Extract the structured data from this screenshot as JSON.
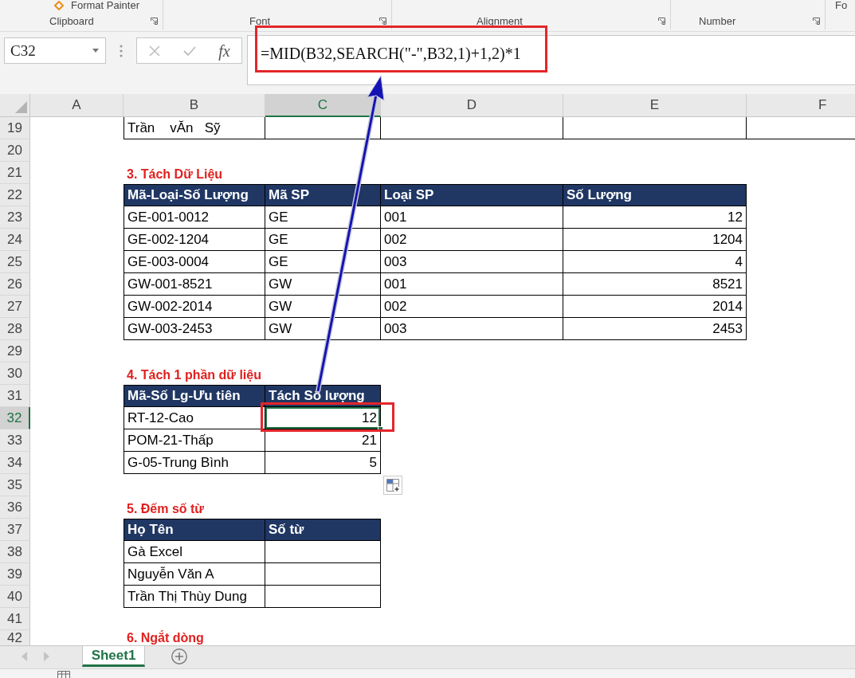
{
  "ribbon": {
    "groups": [
      {
        "label": "Clipboard",
        "items": [
          {
            "kind": "format-painter",
            "label": "Format Painter"
          }
        ]
      },
      {
        "label": "Font"
      },
      {
        "label": "Alignment"
      },
      {
        "label": "Number"
      },
      {
        "items": [
          {
            "kind": "plain",
            "label": "Fo"
          }
        ]
      }
    ]
  },
  "formula_bar": {
    "name_box": "C32",
    "insert_function": "fx",
    "formula": "=MID(B32,SEARCH(\"-\",B32,1)+1,2)*1"
  },
  "sheet": {
    "columns": [
      {
        "label": "A",
        "selected": false
      },
      {
        "label": "B",
        "selected": false
      },
      {
        "label": "C",
        "selected": true
      },
      {
        "label": "D",
        "selected": false
      },
      {
        "label": "E",
        "selected": false
      },
      {
        "label": "F",
        "selected": false
      }
    ],
    "rows": [
      {
        "number": "19",
        "selected": false,
        "cells": [
          {
            "kind": "none"
          },
          {
            "kind": "text",
            "text": "Trần    vĂn   Sỹ"
          },
          {
            "kind": "blank"
          },
          {
            "kind": "blank"
          },
          {
            "kind": "blank"
          },
          {
            "kind": "blank"
          }
        ]
      },
      {
        "number": "20",
        "selected": false,
        "cells": [
          {
            "kind": "none"
          },
          {
            "kind": "none"
          },
          {
            "kind": "none"
          },
          {
            "kind": "none"
          },
          {
            "kind": "none"
          },
          {
            "kind": "none"
          }
        ]
      },
      {
        "number": "21",
        "selected": false,
        "cells": [
          {
            "kind": "none"
          },
          {
            "kind": "title",
            "text": "3. Tách Dữ Liệu"
          },
          {
            "kind": "none"
          },
          {
            "kind": "none"
          },
          {
            "kind": "none"
          },
          {
            "kind": "none"
          }
        ]
      },
      {
        "number": "22",
        "selected": false,
        "cells": [
          {
            "kind": "none"
          },
          {
            "kind": "header",
            "text": "Mã-Loại-Số Lượng"
          },
          {
            "kind": "header",
            "text": "Mã SP"
          },
          {
            "kind": "header",
            "text": "Loại SP"
          },
          {
            "kind": "header",
            "text": "Số Lượng"
          },
          {
            "kind": "none"
          }
        ]
      },
      {
        "number": "23",
        "selected": false,
        "cells": [
          {
            "kind": "none"
          },
          {
            "kind": "text",
            "text": "GE-001-0012"
          },
          {
            "kind": "text",
            "text": "GE"
          },
          {
            "kind": "text",
            "text": "001"
          },
          {
            "kind": "number",
            "text": "12"
          },
          {
            "kind": "none"
          }
        ]
      },
      {
        "number": "24",
        "selected": false,
        "cells": [
          {
            "kind": "none"
          },
          {
            "kind": "text",
            "text": "GE-002-1204"
          },
          {
            "kind": "text",
            "text": "GE"
          },
          {
            "kind": "text",
            "text": "002"
          },
          {
            "kind": "number",
            "text": "1204"
          },
          {
            "kind": "none"
          }
        ]
      },
      {
        "number": "25",
        "selected": false,
        "cells": [
          {
            "kind": "none"
          },
          {
            "kind": "text",
            "text": "GE-003-0004"
          },
          {
            "kind": "text",
            "text": "GE"
          },
          {
            "kind": "text",
            "text": "003"
          },
          {
            "kind": "number",
            "text": "4"
          },
          {
            "kind": "none"
          }
        ]
      },
      {
        "number": "26",
        "selected": false,
        "cells": [
          {
            "kind": "none"
          },
          {
            "kind": "text",
            "text": "GW-001-8521"
          },
          {
            "kind": "text",
            "text": "GW"
          },
          {
            "kind": "text",
            "text": "001"
          },
          {
            "kind": "number",
            "text": "8521"
          },
          {
            "kind": "none"
          }
        ]
      },
      {
        "number": "27",
        "selected": false,
        "cells": [
          {
            "kind": "none"
          },
          {
            "kind": "text",
            "text": "GW-002-2014"
          },
          {
            "kind": "text",
            "text": "GW"
          },
          {
            "kind": "text",
            "text": "002"
          },
          {
            "kind": "number",
            "text": "2014"
          },
          {
            "kind": "none"
          }
        ]
      },
      {
        "number": "28",
        "selected": false,
        "cells": [
          {
            "kind": "none"
          },
          {
            "kind": "text",
            "text": "GW-003-2453"
          },
          {
            "kind": "text",
            "text": "GW"
          },
          {
            "kind": "text",
            "text": "003"
          },
          {
            "kind": "number",
            "text": "2453"
          },
          {
            "kind": "none"
          }
        ]
      },
      {
        "number": "29",
        "selected": false,
        "cells": [
          {
            "kind": "none"
          },
          {
            "kind": "none"
          },
          {
            "kind": "none"
          },
          {
            "kind": "none"
          },
          {
            "kind": "none"
          },
          {
            "kind": "none"
          }
        ]
      },
      {
        "number": "30",
        "selected": false,
        "cells": [
          {
            "kind": "none"
          },
          {
            "kind": "title",
            "text": "4. Tách 1 phần dữ liệu"
          },
          {
            "kind": "none"
          },
          {
            "kind": "none"
          },
          {
            "kind": "none"
          },
          {
            "kind": "none"
          }
        ]
      },
      {
        "number": "31",
        "selected": false,
        "cells": [
          {
            "kind": "none"
          },
          {
            "kind": "header",
            "text": "Mã-Số Lg-Ưu tiên"
          },
          {
            "kind": "header",
            "text": "Tách Số lượng"
          },
          {
            "kind": "none"
          },
          {
            "kind": "none"
          },
          {
            "kind": "none"
          }
        ]
      },
      {
        "number": "32",
        "selected": true,
        "cells": [
          {
            "kind": "none"
          },
          {
            "kind": "text",
            "text": "RT-12-Cao"
          },
          {
            "kind": "number",
            "text": "12"
          },
          {
            "kind": "none"
          },
          {
            "kind": "none"
          },
          {
            "kind": "none"
          }
        ]
      },
      {
        "number": "33",
        "selected": false,
        "cells": [
          {
            "kind": "none"
          },
          {
            "kind": "text",
            "text": "POM-21-Thấp"
          },
          {
            "kind": "number",
            "text": "21"
          },
          {
            "kind": "none"
          },
          {
            "kind": "none"
          },
          {
            "kind": "none"
          }
        ]
      },
      {
        "number": "34",
        "selected": false,
        "cells": [
          {
            "kind": "none"
          },
          {
            "kind": "text",
            "text": "G-05-Trung Bình"
          },
          {
            "kind": "number",
            "text": "5"
          },
          {
            "kind": "none"
          },
          {
            "kind": "none"
          },
          {
            "kind": "none"
          }
        ]
      },
      {
        "number": "35",
        "selected": false,
        "cells": [
          {
            "kind": "none"
          },
          {
            "kind": "none"
          },
          {
            "kind": "none"
          },
          {
            "kind": "none"
          },
          {
            "kind": "none"
          },
          {
            "kind": "none"
          }
        ]
      },
      {
        "number": "36",
        "selected": false,
        "cells": [
          {
            "kind": "none"
          },
          {
            "kind": "title",
            "text": "5. Đếm số từ"
          },
          {
            "kind": "none"
          },
          {
            "kind": "none"
          },
          {
            "kind": "none"
          },
          {
            "kind": "none"
          }
        ]
      },
      {
        "number": "37",
        "selected": false,
        "cells": [
          {
            "kind": "none"
          },
          {
            "kind": "header",
            "text": "Họ Tên"
          },
          {
            "kind": "header",
            "text": "Số từ"
          },
          {
            "kind": "none"
          },
          {
            "kind": "none"
          },
          {
            "kind": "none"
          }
        ]
      },
      {
        "number": "38",
        "selected": false,
        "cells": [
          {
            "kind": "none"
          },
          {
            "kind": "text",
            "text": "Gà Excel"
          },
          {
            "kind": "blank"
          },
          {
            "kind": "none"
          },
          {
            "kind": "none"
          },
          {
            "kind": "none"
          }
        ]
      },
      {
        "number": "39",
        "selected": false,
        "cells": [
          {
            "kind": "none"
          },
          {
            "kind": "text",
            "text": "Nguyễn Văn A"
          },
          {
            "kind": "blank"
          },
          {
            "kind": "none"
          },
          {
            "kind": "none"
          },
          {
            "kind": "none"
          }
        ]
      },
      {
        "number": "40",
        "selected": false,
        "cells": [
          {
            "kind": "none"
          },
          {
            "kind": "text",
            "text": "Trần Thị Thùy Dung"
          },
          {
            "kind": "blank"
          },
          {
            "kind": "none"
          },
          {
            "kind": "none"
          },
          {
            "kind": "none"
          }
        ]
      },
      {
        "number": "41",
        "selected": false,
        "cells": [
          {
            "kind": "none"
          },
          {
            "kind": "none"
          },
          {
            "kind": "none"
          },
          {
            "kind": "none"
          },
          {
            "kind": "none"
          },
          {
            "kind": "none"
          }
        ]
      },
      {
        "number": "42",
        "selected": false,
        "cells": [
          {
            "kind": "none"
          },
          {
            "kind": "title",
            "text": "6. Ngắt dòng"
          },
          {
            "kind": "none"
          },
          {
            "kind": "none"
          },
          {
            "kind": "none"
          },
          {
            "kind": "none"
          }
        ]
      }
    ]
  },
  "sheet_tabs": [
    {
      "label": "Sheet1",
      "selected": true
    }
  ]
}
